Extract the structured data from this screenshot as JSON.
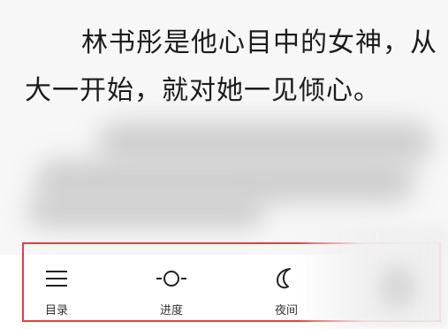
{
  "reader": {
    "line1": "林书彤是他心目中的女神，从",
    "line2": "大一开始，就对她一见倾心。"
  },
  "toolbar": {
    "items": [
      {
        "label": "目录",
        "icon": "menu-list-icon"
      },
      {
        "label": "进度",
        "icon": "progress-slider-icon"
      },
      {
        "label": "夜间",
        "icon": "moon-icon"
      }
    ]
  },
  "colors": {
    "highlight_border": "#e0413f",
    "page_background": "#f7f7f7",
    "toolbar_background": "#ffffff"
  }
}
